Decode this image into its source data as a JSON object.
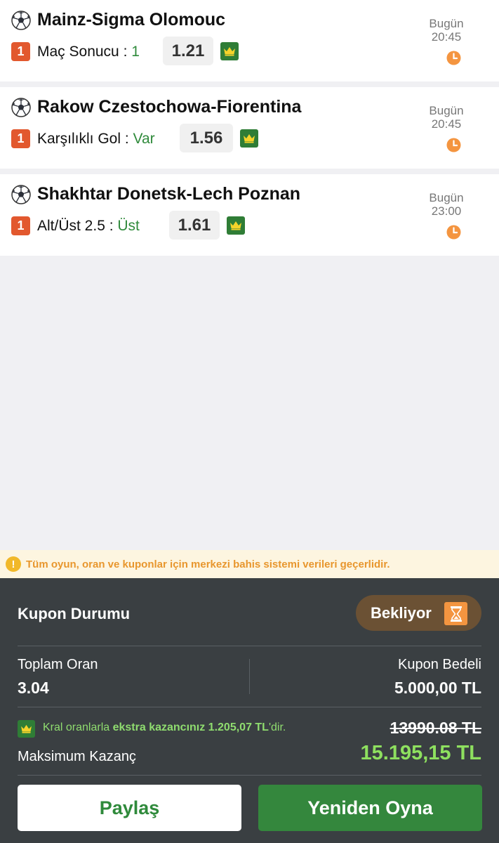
{
  "matches": [
    {
      "title": "Mainz-Sigma Olomouc",
      "pick": "1",
      "market": "Maç Sonucu : ",
      "selection": "1",
      "odds": "1.21",
      "day": "Bugün",
      "time": "20:45"
    },
    {
      "title": "Rakow Czestochowa-Fiorentina",
      "pick": "1",
      "market": "Karşılıklı Gol : ",
      "selection": "Var",
      "odds": "1.56",
      "day": "Bugün",
      "time": "20:45"
    },
    {
      "title": "Shakhtar Donetsk-Lech Poznan",
      "pick": "1",
      "market": "Alt/Üst 2.5 : ",
      "selection": "Üst",
      "odds": "1.61",
      "day": "Bugün",
      "time": "23:00"
    }
  ],
  "notice": {
    "text": "Tüm oyun, oran ve kuponlar için merkezi bahis sistemi verileri geçerlidir.",
    "icon": "!"
  },
  "coupon": {
    "status_label": "Kupon Durumu",
    "status_value": "Bekliyor",
    "total_odds_label": "Toplam Oran",
    "total_odds_value": "3.04",
    "stake_label": "Kupon Bedeli",
    "stake_value": "5.000,00 TL",
    "kral_prefix": "Kral oranlarla ",
    "kral_bold": "ekstra kazancınız 1.205,07 TL",
    "kral_suffix": "'dir.",
    "old_win": "13990.08 TL",
    "max_win_label": "Maksimum Kazanç",
    "max_win_value": "15.195,15 TL"
  },
  "buttons": {
    "share": "Paylaş",
    "replay": "Yeniden Oyna"
  },
  "colors": {
    "accent_green": "#34873d",
    "pick_orange": "#e2582e",
    "clock_orange": "#f49540",
    "panel_bg": "#3a3f42"
  },
  "icons": {
    "sport": "soccer-ball-icon",
    "boost": "crown-icon",
    "time": "clock-icon",
    "status": "hourglass-icon",
    "notice": "warning-icon"
  }
}
